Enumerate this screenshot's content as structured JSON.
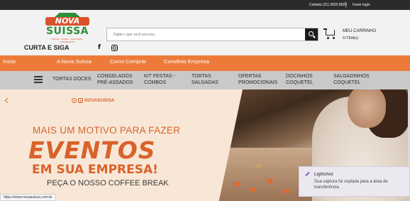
{
  "topbar": {
    "contact": "Contato (21) 3622-8928",
    "login": "Fazer login"
  },
  "logo": {
    "nova": "NOVA",
    "suissa": "SUISSA",
    "tagline": "TORTAS · DOCES · SALGADOS · CONGELADOS"
  },
  "social": {
    "tagline": "CURTA E SIGA",
    "facebook_icon": "f"
  },
  "search": {
    "placeholder": "Digite o que você procura..."
  },
  "cart": {
    "title": "MEU CARRINHO",
    "count": "0 ITEM(s)"
  },
  "orange_nav": [
    "Início",
    "A Nova Suissa",
    "Como Comprar",
    "Convênio Empresa"
  ],
  "categories": [
    {
      "line1": "TORTAS DOCES",
      "line2": ""
    },
    {
      "line1": "CONGELADOS",
      "line2": "PRÉ-ASSADOS"
    },
    {
      "line1": "KIT FESTAS -",
      "line2": "COMBOS"
    },
    {
      "line1": "TORTAS",
      "line2": "SALGADAS"
    },
    {
      "line1": "OFERTAS",
      "line2": "PROMOCIONAIS"
    },
    {
      "line1": "DOCINHOS",
      "line2": "COQUETEL"
    },
    {
      "line1": "SALGADINHOS",
      "line2": "COQUETEL"
    }
  ],
  "banner": {
    "handle": "NOVASUISSA",
    "line1": "MAIS UM MOTIVO PARA FAZER",
    "line2": "EVENTOS",
    "line3": "EM SUA EMPRESA!",
    "line4": "PEÇA O NOSSO COFFEE BREAK",
    "photo_sign": "SUISSA"
  },
  "status_url": "https://www.novasuissa.com.br",
  "toast": {
    "title": "Lightshot",
    "message": "Sua captura foi copiada para a área de transferência"
  },
  "colors": {
    "orange": "#ec7b3a",
    "green": "#2f8f3a",
    "topbar": "#2b2b2b"
  }
}
